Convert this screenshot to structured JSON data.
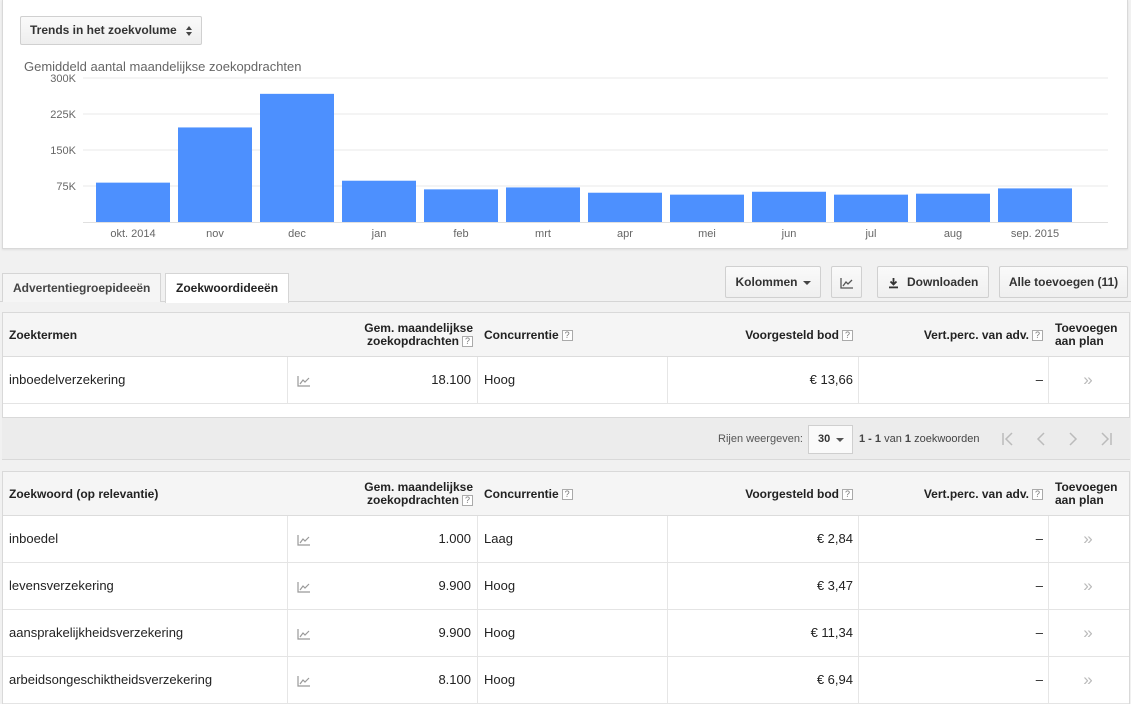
{
  "trend_select": {
    "label": "Trends in het zoekvolume"
  },
  "chart_data": {
    "type": "bar",
    "title": "Gemiddeld aantal maandelijkse zoekopdrachten",
    "categories": [
      "okt. 2014",
      "nov",
      "dec",
      "jan",
      "feb",
      "mrt",
      "apr",
      "mei",
      "jun",
      "jul",
      "aug",
      "sep. 2015"
    ],
    "values": [
      82000,
      197000,
      267000,
      86000,
      68000,
      72000,
      61000,
      57000,
      63000,
      57000,
      59000,
      70000
    ],
    "ylim": [
      0,
      300000
    ],
    "yticks": [
      "75K",
      "150K",
      "225K",
      "300K"
    ],
    "ytick_values": [
      75000,
      150000,
      225000,
      300000
    ],
    "bar_color": "#4d90fe",
    "grid": true
  },
  "tabs": [
    {
      "label": "Advertentiegroepideeën",
      "active": false
    },
    {
      "label": "Zoekwoordideeën",
      "active": true
    }
  ],
  "toolbar": {
    "columns_label": "Kolommen",
    "download_label": "Downloaden",
    "add_all_label": "Alle toevoegen (11)"
  },
  "table1": {
    "headers": {
      "term": "Zoektermen",
      "volume_l1": "Gem. maandelijkse",
      "volume_l2": "zoekopdrachten",
      "competition": "Concurrentie",
      "bid": "Voorgesteld bod",
      "vert": "Vert.perc. van adv.",
      "add_l1": "Toevoegen",
      "add_l2": "aan plan"
    },
    "rows": [
      {
        "term": "inboedelverzekering",
        "volume": "18.100",
        "competition": "Hoog",
        "bid": "€ 13,66",
        "vert": "–",
        "add": "»"
      }
    ]
  },
  "pager": {
    "rows_label": "Rijen weergeven:",
    "rows_value": "30",
    "range": "1 - 1",
    "of": "van",
    "total": "1",
    "unit": "zoekwoorden"
  },
  "table2": {
    "headers": {
      "term": "Zoekwoord (op relevantie)",
      "volume_l1": "Gem. maandelijkse",
      "volume_l2": "zoekopdrachten",
      "competition": "Concurrentie",
      "bid": "Voorgesteld bod",
      "vert": "Vert.perc. van adv.",
      "add_l1": "Toevoegen",
      "add_l2": "aan plan"
    },
    "rows": [
      {
        "term": "inboedel",
        "volume": "1.000",
        "competition": "Laag",
        "bid": "€ 2,84",
        "vert": "–",
        "add": "»"
      },
      {
        "term": "levensverzekering",
        "volume": "9.900",
        "competition": "Hoog",
        "bid": "€ 3,47",
        "vert": "–",
        "add": "»"
      },
      {
        "term": "aansprakelijkheidsverzekering",
        "volume": "9.900",
        "competition": "Hoog",
        "bid": "€ 11,34",
        "vert": "–",
        "add": "»"
      },
      {
        "term": "arbeidsongeschiktheidsverzekering",
        "volume": "8.100",
        "competition": "Hoog",
        "bid": "€ 6,94",
        "vert": "–",
        "add": "»"
      }
    ]
  },
  "icons": {
    "help": "help-icon",
    "trend": "trend-chart-icon",
    "download": "download-icon",
    "add_chevron": "double-chevron-right-icon"
  }
}
